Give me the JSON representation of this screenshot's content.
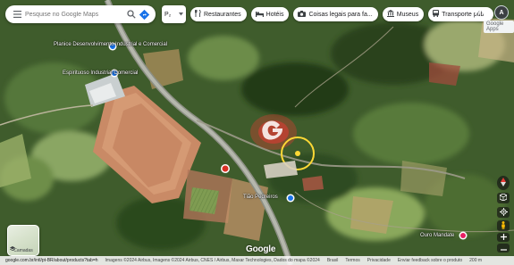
{
  "search": {
    "placeholder": "Pesquise no Google Maps"
  },
  "view_toggle": {
    "label": "P₂"
  },
  "chips": [
    {
      "label": "Restaurantes",
      "icon": "fork-knife-icon"
    },
    {
      "label": "Hotéis",
      "icon": "bed-icon"
    },
    {
      "label": "Coisas legais para fa...",
      "icon": "camera-icon"
    },
    {
      "label": "Museus",
      "icon": "museum-icon"
    },
    {
      "label": "Transporte púb",
      "icon": "bus-icon"
    }
  ],
  "account": {
    "initial": "A",
    "tag": "Google Apps"
  },
  "map_labels": {
    "poi1": "Planice Desenvolvimento Industrial e Comercial",
    "poi2": "Espirituoso Industrial Comercial",
    "poi3": "Tião Pedreiros",
    "poi4": "Ouro Mandate"
  },
  "layers_button": {
    "label": "Camadas"
  },
  "google_logo": "Google",
  "footer": {
    "url": "google.com.br/intl/pt-BR/about/products?tab=h",
    "attribution": "Imagens ©2024 Airbus, Imagens ©2024 Airbus, CNES / Airbus, Maxar Technologies, Dados do mapa ©2024",
    "links": [
      "Brasil",
      "Termos",
      "Privacidade",
      "Enviar feedback sobre o produto"
    ],
    "scale": "200 m"
  },
  "colors": {
    "accent": "#1a73e8",
    "marker_red": "#d93025",
    "highlight_circle": "#fdd835"
  }
}
